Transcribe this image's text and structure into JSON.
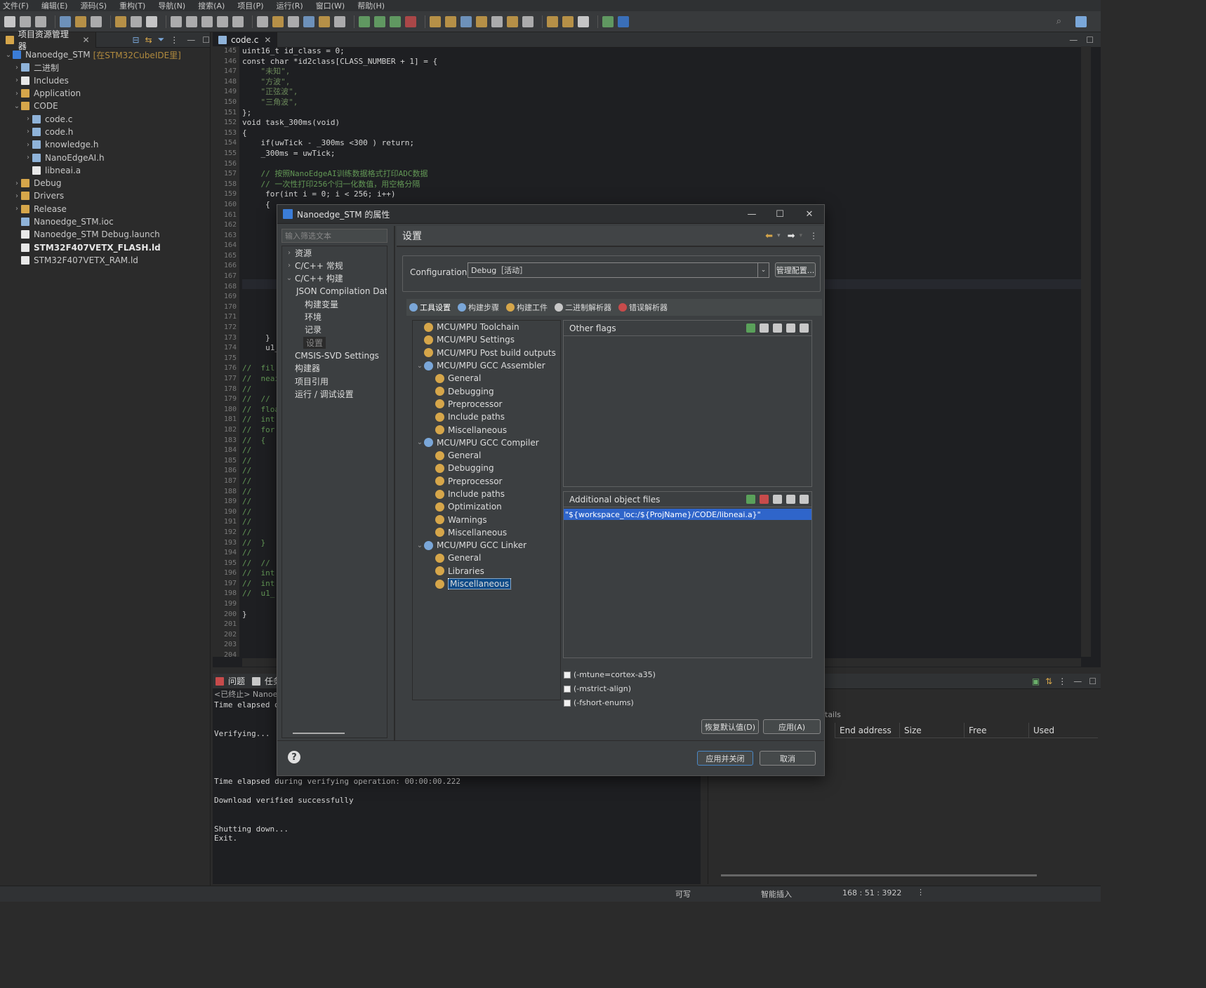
{
  "menu": [
    "文件(F)",
    "编辑(E)",
    "源码(S)",
    "重构(T)",
    "导航(N)",
    "搜索(A)",
    "项目(P)",
    "运行(R)",
    "窗口(W)",
    "帮助(H)"
  ],
  "explorer": {
    "tab_label": "项目资源管理器",
    "project": "Nanoedge_STM",
    "project_suffix": "[在STM32CubeIDE里]",
    "items": [
      {
        "label": "二进制",
        "level": 1,
        "exp": "collapsed"
      },
      {
        "label": "Includes",
        "level": 1,
        "exp": "collapsed"
      },
      {
        "label": "Application",
        "level": 1,
        "exp": "collapsed"
      },
      {
        "label": "CODE",
        "level": 1,
        "exp": "expanded"
      },
      {
        "label": "code.c",
        "level": 2,
        "exp": "collapsed"
      },
      {
        "label": "code.h",
        "level": 2,
        "exp": "collapsed"
      },
      {
        "label": "knowledge.h",
        "level": 2,
        "exp": "collapsed"
      },
      {
        "label": "NanoEdgeAI.h",
        "level": 2,
        "exp": "collapsed"
      },
      {
        "label": "libneai.a",
        "level": 2,
        "exp": "none"
      },
      {
        "label": "Debug",
        "level": 1,
        "exp": "collapsed"
      },
      {
        "label": "Drivers",
        "level": 1,
        "exp": "collapsed"
      },
      {
        "label": "Release",
        "level": 1,
        "exp": "collapsed"
      },
      {
        "label": "Nanoedge_STM.ioc",
        "level": 1,
        "exp": "none"
      },
      {
        "label": "Nanoedge_STM Debug.launch",
        "level": 1,
        "exp": "none"
      },
      {
        "label": "STM32F407VETX_FLASH.ld",
        "level": 1,
        "exp": "none",
        "bold": true
      },
      {
        "label": "STM32F407VETX_RAM.ld",
        "level": 1,
        "exp": "none"
      }
    ]
  },
  "editor": {
    "tab_label": "code.c",
    "line_numbers": [
      "145",
      "146",
      "147",
      "148",
      "149",
      "150",
      "151",
      "152",
      "153",
      "154",
      "155",
      "156",
      "157",
      "158",
      "159",
      "160",
      "161",
      "162",
      "163",
      "164",
      "165",
      "166",
      "167",
      "168",
      "169",
      "170",
      "171",
      "172",
      "173",
      "174",
      "175",
      "176",
      "177",
      "178",
      "179",
      "180",
      "181",
      "182",
      "183",
      "184",
      "185",
      "186",
      "187",
      "188",
      "189",
      "190",
      "191",
      "192",
      "193",
      "194",
      "195",
      "196",
      "197",
      "198",
      "199",
      "200",
      "201",
      "202",
      "203",
      "204"
    ],
    "lines": [
      "uint16_t id_class = 0;",
      "const char *id2class[CLASS_NUMBER + 1] = {",
      "    \"未知\",",
      "    \"方波\",",
      "    \"正弦波\",",
      "    \"三角波\",",
      "};",
      "void task_300ms(void)",
      "{",
      "    if(uwTick - _300ms <300 ) return;",
      "    _300ms = uwTick;",
      "",
      "    // 按照NanoEdgeAI训练数据格式打印ADC数据",
      "    // 一次性打印256个归一化数值，用空格分隔",
      "     for(int i = 0; i < 256; i++)",
      "     {",
      "",
      "",
      "",
      "",
      "",
      "",
      "",
      "",
      "",
      "",
      "",
      "",
      "     }",
      "     u1_",
      "",
      "//  fil",
      "//  neai",
      "//",
      "//  // ",
      "//  floa",
      "//  int",
      "//  for",
      "//  {",
      "//",
      "//",
      "//",
      "//",
      "//",
      "//",
      "//",
      "//",
      "//",
      "//  }",
      "//",
      "//  // ",
      "//  int",
      "//  int",
      "//  u1_",
      "",
      "}",
      "",
      "",
      ""
    ]
  },
  "console": {
    "tabs": [
      "问题",
      "任务"
    ],
    "terminated": "<已终止> Nanoe",
    "lines": [
      "Time elapsed d",
      "",
      "",
      "Verifying...",
      "",
      "",
      "",
      "",
      "Time elapsed during verifying operation: 00:00:00.222",
      "",
      "Download verified successfully",
      "",
      "",
      "Shutting down...",
      "Exit."
    ]
  },
  "memory": {
    "partial_header": "tails",
    "columns": [
      "End address",
      "Size",
      "Free",
      "Used"
    ]
  },
  "status": {
    "writable": "可写",
    "insert": "智能插入",
    "position": "168 : 51 : 3922"
  },
  "dialog": {
    "title": "Nanoedge_STM 的属性",
    "filter_placeholder": "输入筛选文本",
    "nav": [
      {
        "label": "资源",
        "level": 0,
        "exp": "collapsed"
      },
      {
        "label": "C/C++ 常规",
        "level": 0,
        "exp": "collapsed"
      },
      {
        "label": "C/C++ 构建",
        "level": 0,
        "exp": "expanded"
      },
      {
        "label": "JSON Compilation Dat",
        "level": 1,
        "exp": "none"
      },
      {
        "label": "构建变量",
        "level": 1,
        "exp": "none"
      },
      {
        "label": "环境",
        "level": 1,
        "exp": "none"
      },
      {
        "label": "记录",
        "level": 1,
        "exp": "none"
      },
      {
        "label": "设置",
        "level": 1,
        "exp": "none",
        "selected": true
      },
      {
        "label": "CMSIS-SVD Settings",
        "level": 0,
        "exp": "none"
      },
      {
        "label": "构建器",
        "level": 0,
        "exp": "none"
      },
      {
        "label": "项目引用",
        "level": 0,
        "exp": "none"
      },
      {
        "label": "运行 / 调试设置",
        "level": 0,
        "exp": "none"
      }
    ],
    "page_title": "设置",
    "config_label": "Configuration:",
    "config_value": "Debug［活动］",
    "manage_button": "管理配置...",
    "subtabs": [
      "工具设置",
      "构建步骤",
      "构建工件",
      "二进制解析器",
      "错误解析器"
    ],
    "tool_tree": [
      {
        "label": "MCU/MPU Toolchain",
        "level": 0,
        "exp": "none"
      },
      {
        "label": "MCU/MPU Settings",
        "level": 0,
        "exp": "none"
      },
      {
        "label": "MCU/MPU Post build outputs",
        "level": 0,
        "exp": "none"
      },
      {
        "label": "MCU/MPU GCC Assembler",
        "level": 0,
        "exp": "expanded"
      },
      {
        "label": "General",
        "level": 1
      },
      {
        "label": "Debugging",
        "level": 1
      },
      {
        "label": "Preprocessor",
        "level": 1
      },
      {
        "label": "Include paths",
        "level": 1
      },
      {
        "label": "Miscellaneous",
        "level": 1
      },
      {
        "label": "MCU/MPU GCC Compiler",
        "level": 0,
        "exp": "expanded"
      },
      {
        "label": "General",
        "level": 1
      },
      {
        "label": "Debugging",
        "level": 1
      },
      {
        "label": "Preprocessor",
        "level": 1
      },
      {
        "label": "Include paths",
        "level": 1
      },
      {
        "label": "Optimization",
        "level": 1
      },
      {
        "label": "Warnings",
        "level": 1
      },
      {
        "label": "Miscellaneous",
        "level": 1
      },
      {
        "label": "MCU/MPU GCC Linker",
        "level": 0,
        "exp": "expanded"
      },
      {
        "label": "General",
        "level": 1
      },
      {
        "label": "Libraries",
        "level": 1
      },
      {
        "label": "Miscellaneous",
        "level": 1,
        "selected": true
      }
    ],
    "other_flags_title": "Other flags",
    "additional_objects_title": "Additional object files",
    "additional_object_value": "\"${workspace_loc:/${ProjName}/CODE/libneai.a}\"",
    "checkboxes": [
      "(-mtune=cortex-a35)",
      "(-mstrict-align)",
      "(-fshort-enums)"
    ],
    "restore_defaults": "恢复默认值(D)",
    "apply": "应用(A)",
    "apply_close": "应用并关闭",
    "cancel": "取消"
  },
  "colors": {
    "accent": "#2f65ca",
    "selection": "#0d5aa7",
    "dialog_bg": "#3c3f41",
    "editor_bg": "#1e1f22"
  }
}
